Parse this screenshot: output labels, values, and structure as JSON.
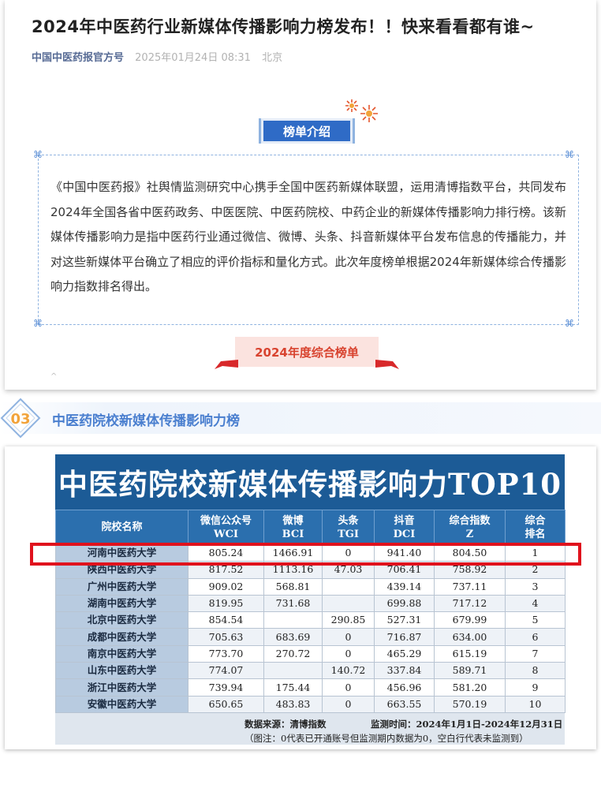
{
  "article": {
    "title": "2024年中医药行业新媒体传播影响力榜发布！！快来看看都有谁~",
    "source": "中国中医药报官方号",
    "date": "2025年01月24日 08:31",
    "location": "北京"
  },
  "intro": {
    "badge": "榜单介绍",
    "text": "《中国中医药报》社舆情监测研究中心携手全国中医药新媒体联盟，运用清博指数平台，共同发布2024年全国各省中医药政务、中医医院、中医药院校、中药企业的新媒体传播影响力排行榜。该新媒体传播影响力是指中医药行业通过微信、微博、头条、抖音新媒体平台发布信息的传播能力，并对这些新媒体平台确立了相应的评价指标和量化方式。此次年度榜单根据2024年新媒体综合传播影响力指数排名得出。",
    "annual_badge": "2024年度综合榜单"
  },
  "section": {
    "number": "03",
    "title": "中医药院校新媒体传播影响力榜"
  },
  "table": {
    "banner": "中医药院校新媒体传播影响力TOP10",
    "headers": [
      {
        "l1": "院校名称",
        "l2": ""
      },
      {
        "l1": "微信公众号",
        "l2": "WCI"
      },
      {
        "l1": "微博",
        "l2": "BCI"
      },
      {
        "l1": "头条",
        "l2": "TGI"
      },
      {
        "l1": "抖音",
        "l2": "DCI"
      },
      {
        "l1": "综合指数",
        "l2": "Z"
      },
      {
        "l1": "综合",
        "l2": "排名"
      }
    ],
    "rows": [
      [
        "河南中医药大学",
        "805.24",
        "1466.91",
        "0",
        "941.40",
        "804.50",
        "1"
      ],
      [
        "陕西中医药大学",
        "817.52",
        "1113.16",
        "47.03",
        "706.41",
        "758.92",
        "2"
      ],
      [
        "广州中医药大学",
        "909.02",
        "568.81",
        "",
        "439.14",
        "737.11",
        "3"
      ],
      [
        "湖南中医药大学",
        "819.95",
        "731.68",
        "",
        "699.88",
        "717.12",
        "4"
      ],
      [
        "北京中医药大学",
        "854.54",
        "",
        "290.85",
        "527.31",
        "679.99",
        "5"
      ],
      [
        "成都中医药大学",
        "705.63",
        "683.69",
        "0",
        "716.87",
        "634.00",
        "6"
      ],
      [
        "南京中医药大学",
        "773.70",
        "270.72",
        "0",
        "465.29",
        "615.19",
        "7"
      ],
      [
        "山东中医药大学",
        "774.07",
        "",
        "140.72",
        "337.84",
        "589.71",
        "8"
      ],
      [
        "浙江中医药大学",
        "739.94",
        "175.44",
        "0",
        "456.96",
        "581.20",
        "9"
      ],
      [
        "安徽中医药大学",
        "650.65",
        "483.83",
        "0",
        "663.55",
        "570.19",
        "10"
      ]
    ],
    "footer_source": "数据来源：清博指数",
    "footer_period": "监测时间：2024年1月1日-2024年12月31日",
    "footer_note": "（图注：0代表已开通账号但监测期内数据为0，空白行代表未监测到）"
  },
  "colors": {
    "banner": "#1c5b96",
    "header": "#2b6fae",
    "highlight": "#e0121d",
    "accent_blue": "#2f6bc6",
    "accent_red": "#d8432f"
  }
}
